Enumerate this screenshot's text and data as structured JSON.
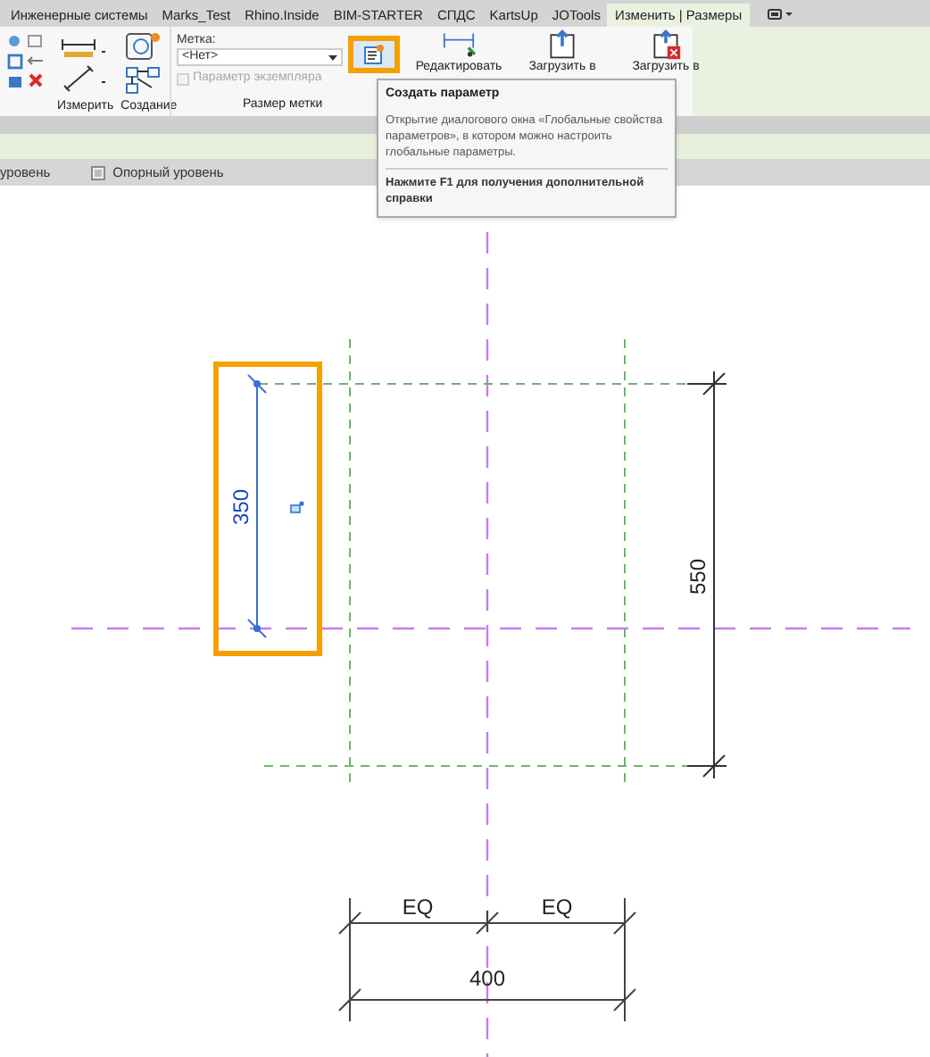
{
  "tabs": [
    {
      "label": "Инженерные системы",
      "selected": false
    },
    {
      "label": "Marks_Test",
      "selected": false
    },
    {
      "label": "Rhino.Inside",
      "selected": false
    },
    {
      "label": "BIM-STARTER",
      "selected": false
    },
    {
      "label": "СПДС",
      "selected": false
    },
    {
      "label": "KartsUp",
      "selected": false
    },
    {
      "label": "JOTools",
      "selected": false
    },
    {
      "label": "Изменить | Размеры",
      "selected": true
    }
  ],
  "ribbon": {
    "measure_label": "Измерить",
    "create_label": "Создание",
    "tag_field_label": "Метка:",
    "tag_value": "<Нет>",
    "instance_checkbox": {
      "label": "Параметр экземпляра",
      "checked": false,
      "disabled": true
    },
    "panel_label": "Размер метки",
    "buttons": [
      {
        "label": "Редактировать"
      },
      {
        "label": "Загрузить в"
      },
      {
        "label": "Загрузить в"
      }
    ]
  },
  "tooltip": {
    "title": "Создать параметр",
    "description": "Открытие диалогового окна «Глобальные свойства параметров», в котором можно настроить глобальные параметры.",
    "help": "Нажмите F1 для получения дополнительной справки"
  },
  "view_bar": {
    "left_text": "уровень",
    "reference_text": "Опорный уровень"
  },
  "drawing": {
    "selected_dimension": "350",
    "vertical_dimension": "550",
    "equal_left": "EQ",
    "equal_right": "EQ",
    "total_dimension": "400"
  }
}
